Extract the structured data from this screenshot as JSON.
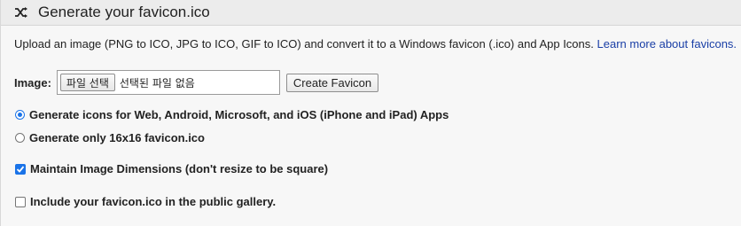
{
  "header": {
    "title": "Generate your favicon.ico",
    "icon": "shuffle-icon"
  },
  "intro": {
    "text": "Upload an image (PNG to ICO, JPG to ICO, GIF to ICO) and convert it to a Windows favicon (.ico) and App Icons. ",
    "link": "Learn more about favicons."
  },
  "image_field": {
    "label": "Image:",
    "choose_button": "파일 선택",
    "no_file_text": "선택된 파일 없음",
    "create_button": "Create Favicon"
  },
  "options": {
    "radio_all": {
      "label": "Generate icons for Web, Android, Microsoft, and iOS (iPhone and iPad) Apps",
      "checked": true
    },
    "radio_16": {
      "label": "Generate only 16x16 favicon.ico",
      "checked": false
    },
    "maintain_dimensions": {
      "label": "Maintain Image Dimensions (don't resize to be square)",
      "checked": true
    },
    "public_gallery": {
      "label": "Include your favicon.ico in the public gallery.",
      "checked": false
    }
  },
  "colors": {
    "accent": "#1a73e8",
    "link": "#1a3fa6"
  }
}
